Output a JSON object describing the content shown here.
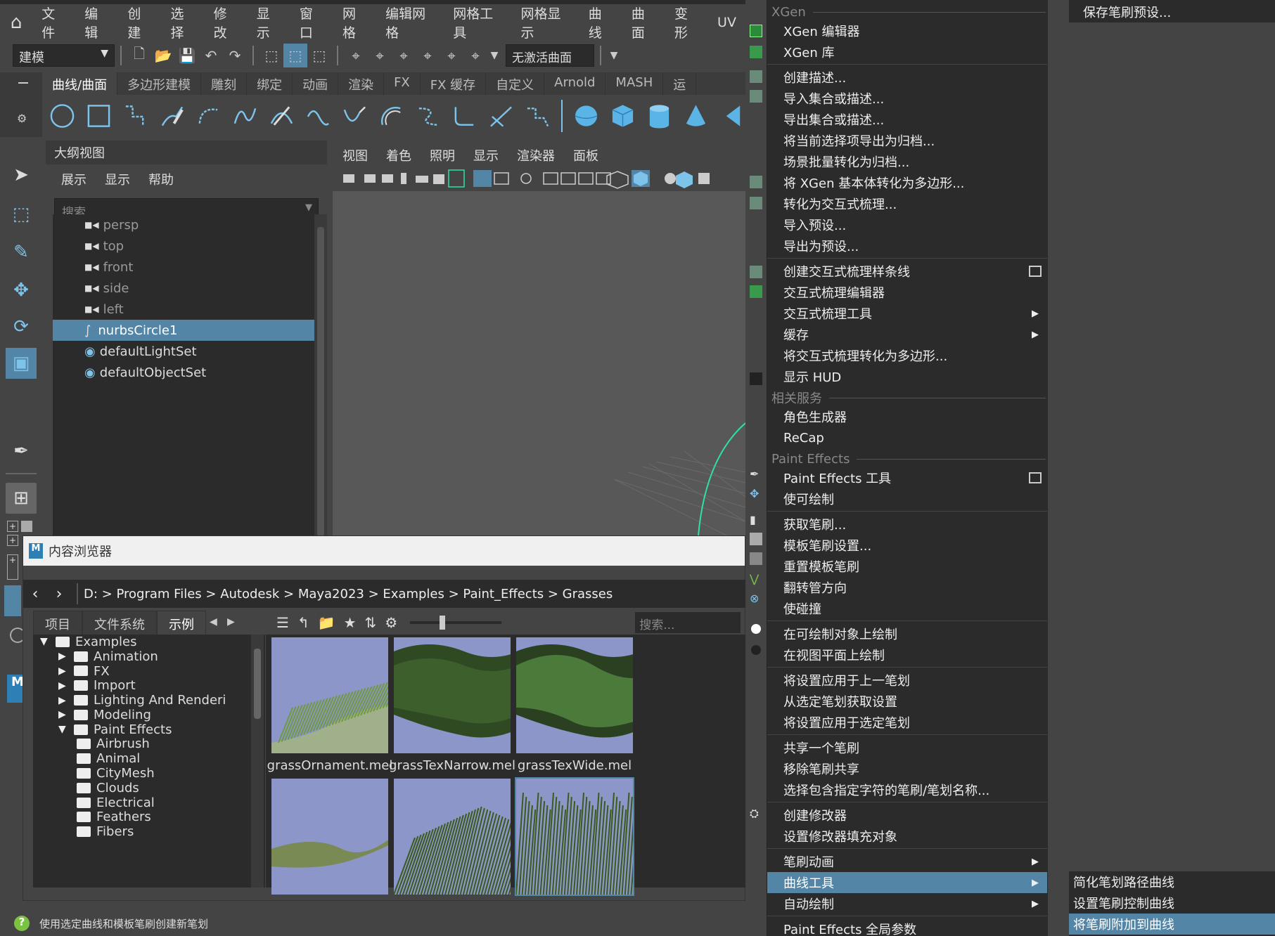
{
  "menubar": {
    "items": [
      "文件",
      "编辑",
      "创建",
      "选择",
      "修改",
      "显示",
      "窗口",
      "网格",
      "编辑网格",
      "网格工具",
      "网格显示",
      "曲线",
      "曲面",
      "变形",
      "UV"
    ]
  },
  "toolbar": {
    "mode": "建模",
    "active_surface": "无激活曲面"
  },
  "shelf": {
    "tabs": [
      "曲线/曲面",
      "多边形建模",
      "雕刻",
      "绑定",
      "动画",
      "渲染",
      "FX",
      "FX 缓存",
      "自定义",
      "Arnold",
      "MASH",
      "运"
    ],
    "active_tab": 0
  },
  "outliner": {
    "title": "大纲视图",
    "menu": [
      "展示",
      "显示",
      "帮助"
    ],
    "search_placeholder": "搜索...",
    "items": [
      {
        "label": "persp",
        "kind": "camera"
      },
      {
        "label": "top",
        "kind": "camera"
      },
      {
        "label": "front",
        "kind": "camera"
      },
      {
        "label": "side",
        "kind": "camera"
      },
      {
        "label": "left",
        "kind": "camera"
      },
      {
        "label": "nurbsCircle1",
        "kind": "curve",
        "selected": true
      },
      {
        "label": "defaultLightSet",
        "kind": "set"
      },
      {
        "label": "defaultObjectSet",
        "kind": "set"
      }
    ]
  },
  "viewport": {
    "menu": [
      "视图",
      "着色",
      "照明",
      "显示",
      "渲染器",
      "面板"
    ]
  },
  "content_browser": {
    "title": "内容浏览器",
    "path": [
      "D:",
      "Program Files",
      "Autodesk",
      "Maya2023",
      "Examples",
      "Paint_Effects",
      "Grasses"
    ],
    "tabs": [
      "项目",
      "文件系统",
      "示例"
    ],
    "active_tab": 2,
    "search_placeholder": "搜索...",
    "tree": [
      {
        "label": "Examples",
        "level": 0,
        "expanded": true
      },
      {
        "label": "Animation",
        "level": 1,
        "expanded": false
      },
      {
        "label": "FX",
        "level": 1,
        "expanded": false
      },
      {
        "label": "Import",
        "level": 1,
        "expanded": false
      },
      {
        "label": "Lighting And Renderi",
        "level": 1,
        "expanded": false
      },
      {
        "label": "Modeling",
        "level": 1,
        "expanded": false
      },
      {
        "label": "Paint Effects",
        "level": 1,
        "expanded": true
      },
      {
        "label": "Airbrush",
        "level": 2
      },
      {
        "label": "Animal",
        "level": 2
      },
      {
        "label": "CityMesh",
        "level": 2
      },
      {
        "label": "Clouds",
        "level": 2
      },
      {
        "label": "Electrical",
        "level": 2
      },
      {
        "label": "Feathers",
        "level": 2
      },
      {
        "label": "Fibers",
        "level": 2
      }
    ],
    "thumbnails": [
      {
        "label": "grassOrnament.mel"
      },
      {
        "label": "grassTexNarrow.mel"
      },
      {
        "label": "grassTexWide.mel"
      },
      {
        "label": ""
      },
      {
        "label": ""
      },
      {
        "label": ""
      }
    ]
  },
  "status": {
    "text": "使用选定曲线和模板笔刷创建新笔划"
  },
  "menu": {
    "sections": [
      {
        "type": "header",
        "label": "XGen"
      },
      {
        "type": "item",
        "label": "XGen 编辑器"
      },
      {
        "type": "item",
        "label": "XGen 库"
      },
      {
        "type": "sep"
      },
      {
        "type": "item",
        "label": "创建描述..."
      },
      {
        "type": "item",
        "label": "导入集合或描述..."
      },
      {
        "type": "item",
        "label": "导出集合或描述..."
      },
      {
        "type": "item",
        "label": "将当前选择项导出为归档..."
      },
      {
        "type": "item",
        "label": "场景批量转化为归档..."
      },
      {
        "type": "item",
        "label": "将 XGen 基本体转化为多边形..."
      },
      {
        "type": "item",
        "label": "转化为交互式梳理..."
      },
      {
        "type": "item",
        "label": "导入预设..."
      },
      {
        "type": "item",
        "label": "导出为预设..."
      },
      {
        "type": "sep"
      },
      {
        "type": "item",
        "label": "创建交互式梳理样条线",
        "option": true
      },
      {
        "type": "item",
        "label": "交互式梳理编辑器"
      },
      {
        "type": "item",
        "label": "交互式梳理工具",
        "submenu": true
      },
      {
        "type": "item",
        "label": "缓存",
        "submenu": true
      },
      {
        "type": "item",
        "label": "将交互式梳理转化为多边形..."
      },
      {
        "type": "item",
        "label": "显示 HUD"
      },
      {
        "type": "header",
        "label": "相关服务"
      },
      {
        "type": "item",
        "label": "角色生成器"
      },
      {
        "type": "item",
        "label": "ReCap"
      },
      {
        "type": "header",
        "label": "Paint Effects"
      },
      {
        "type": "item",
        "label": "Paint Effects 工具",
        "option": true
      },
      {
        "type": "item",
        "label": "使可绘制"
      },
      {
        "type": "sep"
      },
      {
        "type": "item",
        "label": "获取笔刷..."
      },
      {
        "type": "item",
        "label": "模板笔刷设置..."
      },
      {
        "type": "item",
        "label": "重置模板笔刷"
      },
      {
        "type": "item",
        "label": "翻转管方向"
      },
      {
        "type": "item",
        "label": "使碰撞"
      },
      {
        "type": "sep"
      },
      {
        "type": "item",
        "label": "在可绘制对象上绘制"
      },
      {
        "type": "item",
        "label": "在视图平面上绘制"
      },
      {
        "type": "sep"
      },
      {
        "type": "item",
        "label": "将设置应用于上一笔划"
      },
      {
        "type": "item",
        "label": "从选定笔划获取设置"
      },
      {
        "type": "item",
        "label": "将设置应用于选定笔划"
      },
      {
        "type": "sep"
      },
      {
        "type": "item",
        "label": "共享一个笔刷"
      },
      {
        "type": "item",
        "label": "移除笔刷共享"
      },
      {
        "type": "item",
        "label": "选择包含指定字符的笔刷/笔划名称..."
      },
      {
        "type": "sep"
      },
      {
        "type": "item",
        "label": "创建修改器"
      },
      {
        "type": "item",
        "label": "设置修改器填充对象"
      },
      {
        "type": "sep"
      },
      {
        "type": "item",
        "label": "笔刷动画",
        "submenu": true
      },
      {
        "type": "item",
        "label": "曲线工具",
        "submenu": true,
        "highlighted": true
      },
      {
        "type": "item",
        "label": "自动绘制",
        "submenu": true
      },
      {
        "type": "sep"
      },
      {
        "type": "item",
        "label": "Paint Effects 全局参数"
      }
    ]
  },
  "submenu_top": {
    "label": "保存笔刷预设..."
  },
  "submenu": {
    "items": [
      {
        "label": "简化笔划路径曲线"
      },
      {
        "label": "设置笔刷控制曲线"
      },
      {
        "label": "将笔刷附加到曲线",
        "highlighted": true
      }
    ]
  },
  "colors": {
    "highlight": "#5285a6",
    "menu_bg": "#2b2b2b",
    "panel_bg": "#444444"
  }
}
